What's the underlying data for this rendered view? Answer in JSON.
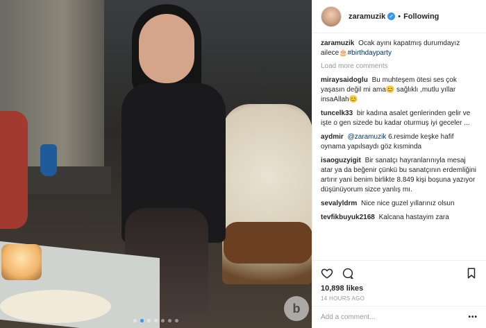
{
  "post": {
    "carousel_pages": 7,
    "carousel_active": 1
  },
  "header": {
    "username": "zaramuzik",
    "separator": "•",
    "follow_label": "Following"
  },
  "caption": {
    "user": "zaramuzik",
    "text": "Ocak ayını kapatmış durumdayız ailece",
    "emoji": "🎂",
    "hashtag": "#birthdayparty"
  },
  "load_more": "Load more comments",
  "comments": [
    {
      "user": "miraysaidoglu",
      "text": "Bu muhteşem ötesi ses çok yaşasın değil mi ama😊 sağlıklı ,mutlu yıllar insaAllah😊"
    },
    {
      "user": "tuncelk33",
      "text": "bir kadına asalet genlerinden gelir ve işte o gen sizede bu kadar oturmuş iyi geceler ..."
    },
    {
      "user": "aydmir",
      "mention": "@zaramuzik",
      "text": " 6.resimde keşke hafif oynama yapılsaydı göz kısminda"
    },
    {
      "user": "isaoguzyigit",
      "text": "Bir sanatçı hayranlarınıyla mesaj atar ya da beğenir çünkü bu sanatçının erdemliğini artırır yani benim birlikte 8.849 kişi boşuna yazıyor düşünüyorum sizce yanlış mı."
    },
    {
      "user": "sevalyldrm",
      "text": "Nice nice guzel yıllarınız olsun"
    },
    {
      "user": "tevfikbuyuk2168",
      "text": "Kalcana hastayim zara"
    }
  ],
  "likes": "10,898 likes",
  "time_ago": "14 HOURS AGO",
  "add_comment_placeholder": "Add a comment...",
  "more_menu": "•••",
  "colors": {
    "accent": "#3897f0",
    "text": "#262626",
    "muted": "#999999",
    "border": "#efefef"
  },
  "icons": [
    "heart-icon",
    "comment-icon",
    "share-icon",
    "bookmark-icon",
    "verified-icon"
  ]
}
